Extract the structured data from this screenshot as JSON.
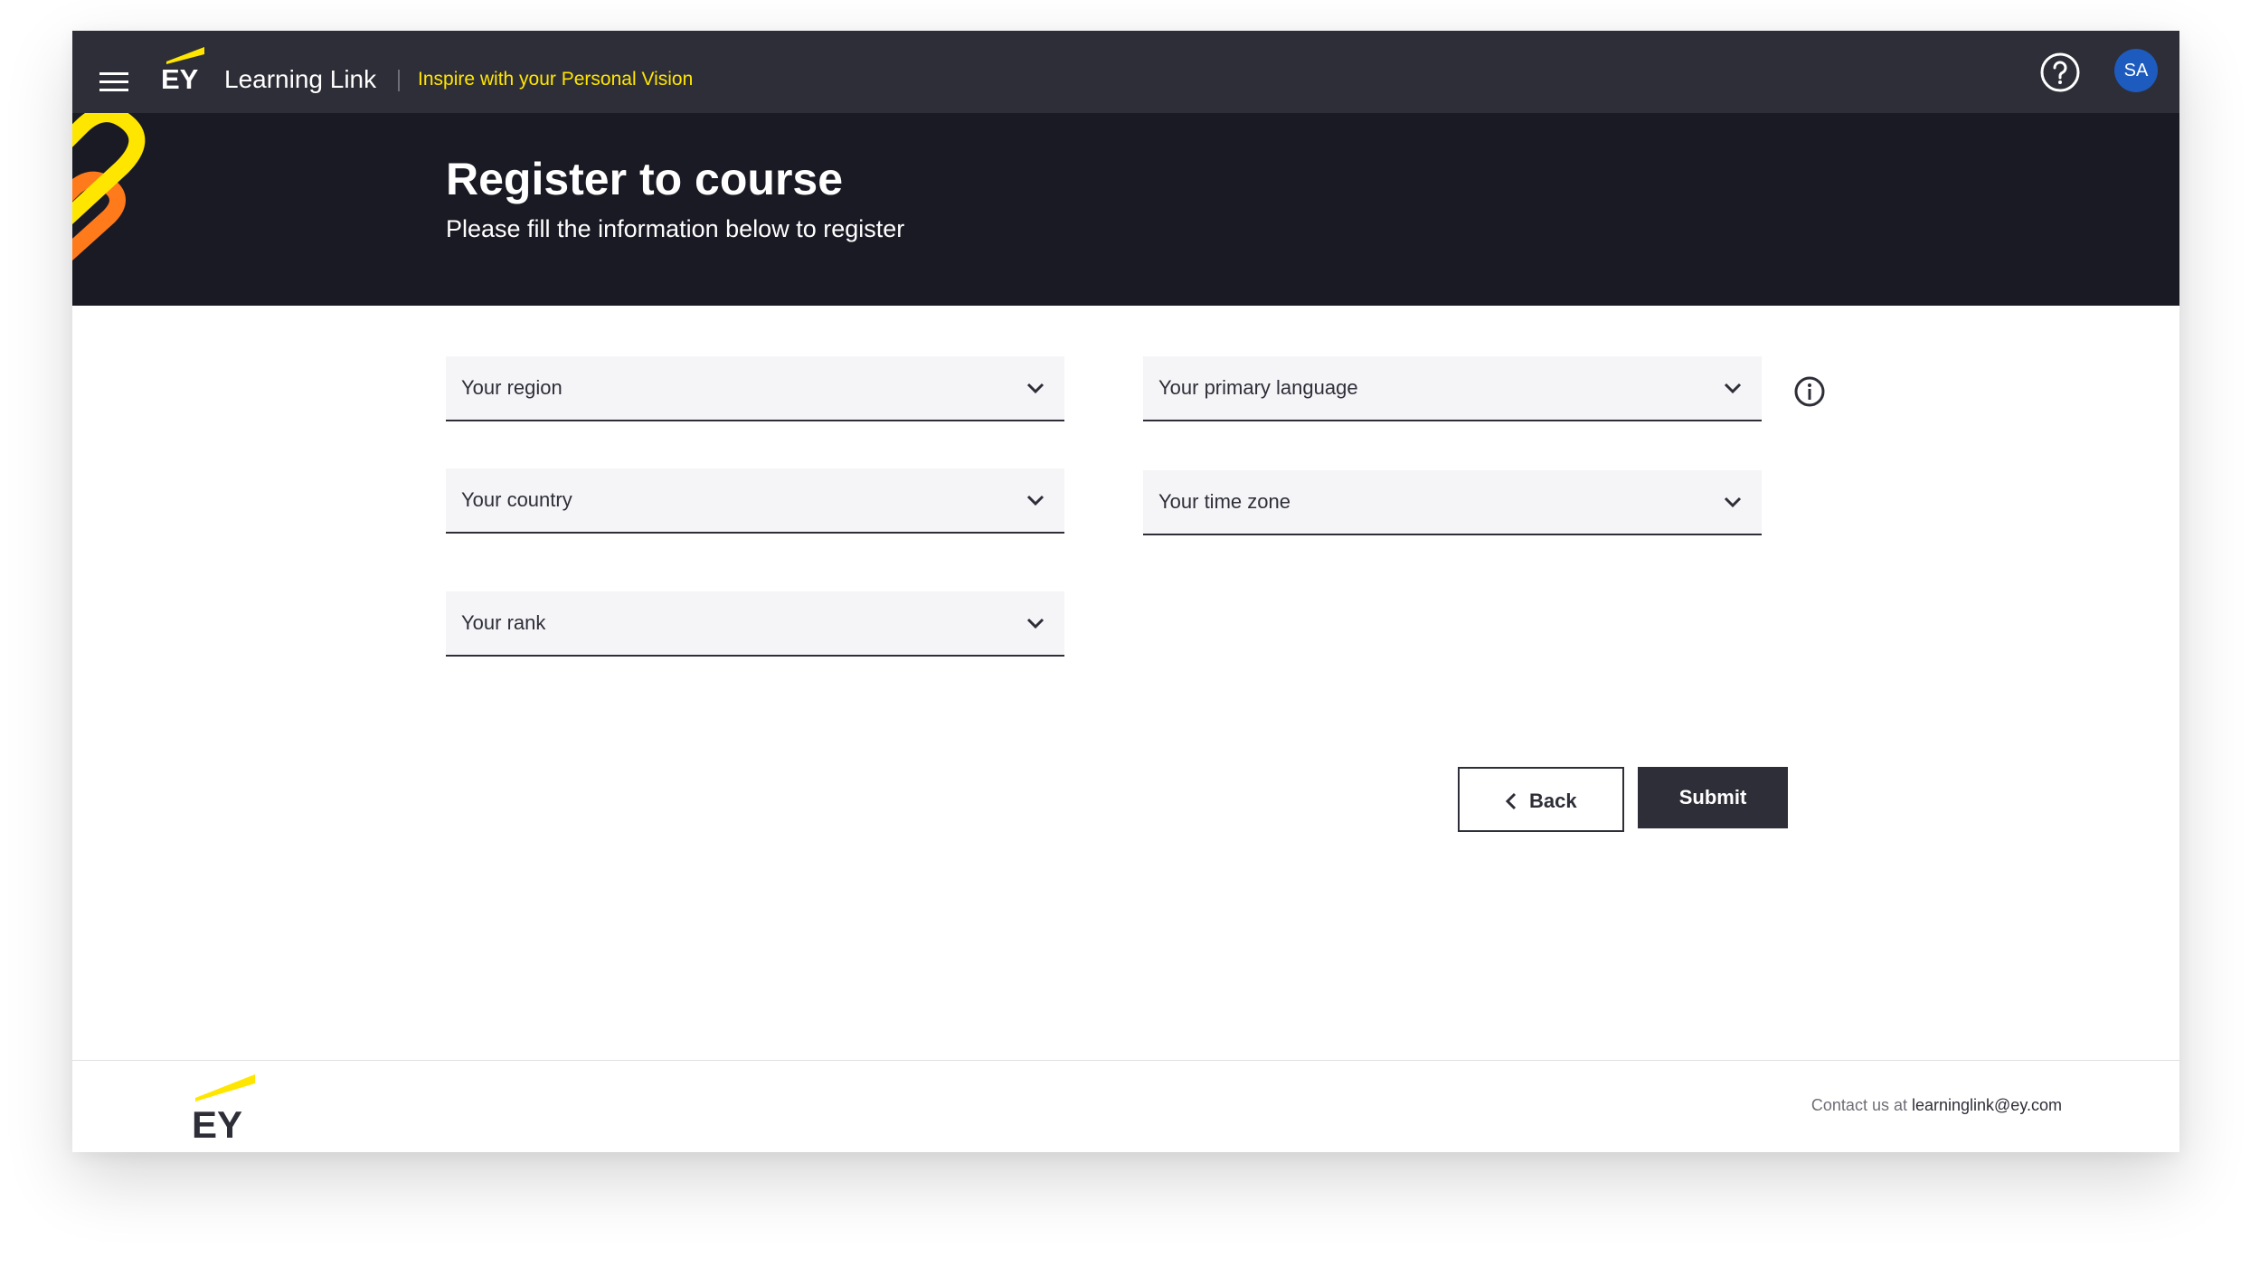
{
  "nav": {
    "logo_text": "EY",
    "app_title": "Learning Link",
    "tagline": "Inspire with your Personal Vision",
    "user_initials": "SA"
  },
  "hero": {
    "title": "Register to course",
    "subtitle": "Please fill the information below to register"
  },
  "form": {
    "region": "Your region",
    "country": "Your country",
    "rank": "Your rank",
    "primary_language": "Your primary language",
    "time_zone": "Your time zone"
  },
  "actions": {
    "back_label": "Back",
    "submit_label": "Submit"
  },
  "footer": {
    "logo_text": "EY",
    "contact_prefix": "Contact us at",
    "contact_email": "learninglink@ey.com"
  },
  "colors": {
    "nav_bg": "#2e2e38",
    "hero_bg": "#1a1a24",
    "accent_yellow": "#ffe600",
    "avatar_blue": "#1d5bbf",
    "field_bg": "#f5f5f8"
  }
}
